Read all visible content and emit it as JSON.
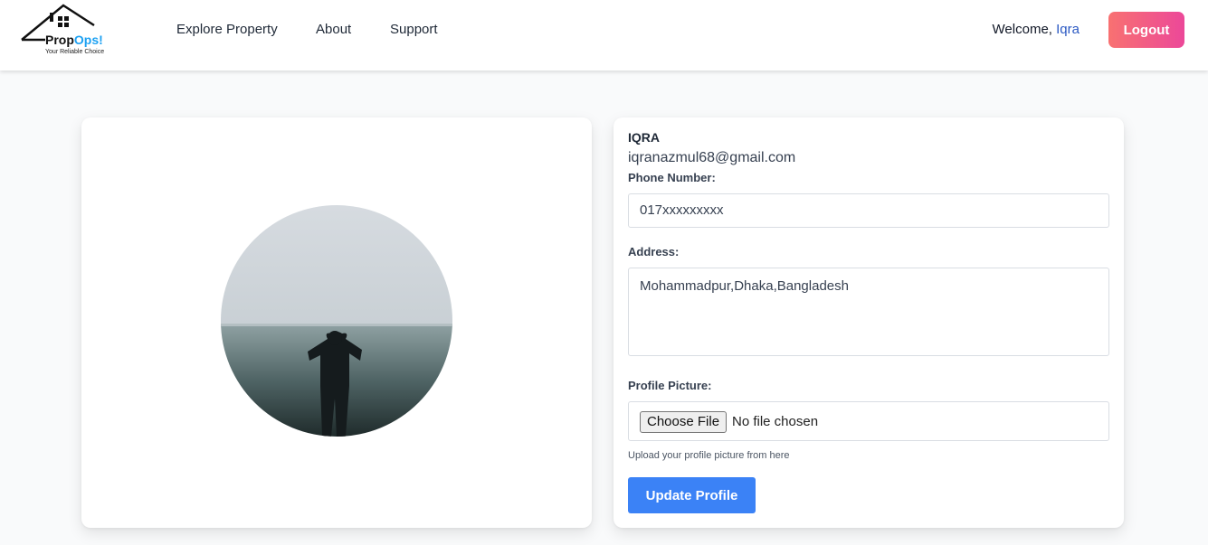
{
  "navbar": {
    "logo": {
      "name": "PropOps",
      "name_accent": "Ops!",
      "name_prefix": "Prop",
      "tagline": "Your Reliable Choice"
    },
    "links": [
      "Explore Property",
      "About",
      "Support"
    ],
    "welcome_prefix": "Welcome,",
    "welcome_user": "Iqra",
    "logout_label": "Logout"
  },
  "profile": {
    "name": "IQRA",
    "email": "iqranazmul68@gmail.com",
    "phone_label": "Phone Number:",
    "phone_value": "017xxxxxxxxx",
    "address_label": "Address:",
    "address_value": "Mohammadpur,Dhaka,Bangladesh",
    "picture_label": "Profile Picture:",
    "choose_file_label": "Choose File",
    "no_file_text": "No file chosen",
    "helper_text": "Upload your profile picture from here",
    "update_label": "Update Profile"
  },
  "colors": {
    "accent_blue": "#3b82f6",
    "logout_gradient_start": "#f87171",
    "logout_gradient_end": "#ec4899",
    "welcome_user": "#2b59c3"
  },
  "icons": [
    "house-logo-icon"
  ]
}
